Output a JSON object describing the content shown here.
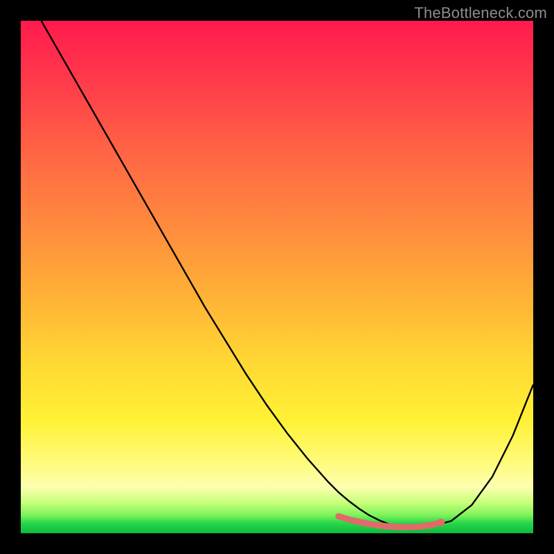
{
  "watermark": "TheBottleneck.com",
  "curve_color": "#000000",
  "curve_width": 2.4,
  "highlight_color": "#e06a6a",
  "highlight_width": 9,
  "highlight_cap": "round",
  "chart_data": {
    "type": "line",
    "title": "",
    "xlabel": "",
    "ylabel": "",
    "xlim": [
      0,
      100
    ],
    "ylim": [
      0,
      100
    ],
    "grid": false,
    "series": [
      {
        "name": "bottleneck_curve",
        "x": [
          4,
          8,
          12,
          16,
          20,
          24,
          28,
          32,
          36,
          40,
          44,
          48,
          52,
          56,
          60,
          62,
          64,
          66,
          68,
          70,
          72,
          74,
          76,
          78,
          80,
          84,
          88,
          92,
          96,
          100
        ],
        "y": [
          100,
          93,
          86,
          79,
          72,
          65,
          58,
          51,
          44,
          37.5,
          31,
          25,
          19.5,
          14.5,
          10,
          8,
          6.3,
          4.8,
          3.5,
          2.5,
          1.7,
          1.3,
          1.1,
          1.1,
          1.3,
          2.4,
          5.5,
          11,
          19,
          29
        ]
      }
    ],
    "highlight_segment": {
      "x": [
        62,
        64,
        66,
        68,
        70,
        72,
        74,
        76,
        78,
        80,
        82
      ],
      "y": [
        3.3,
        2.7,
        2.2,
        1.8,
        1.5,
        1.3,
        1.2,
        1.2,
        1.3,
        1.6,
        2.1
      ]
    }
  }
}
